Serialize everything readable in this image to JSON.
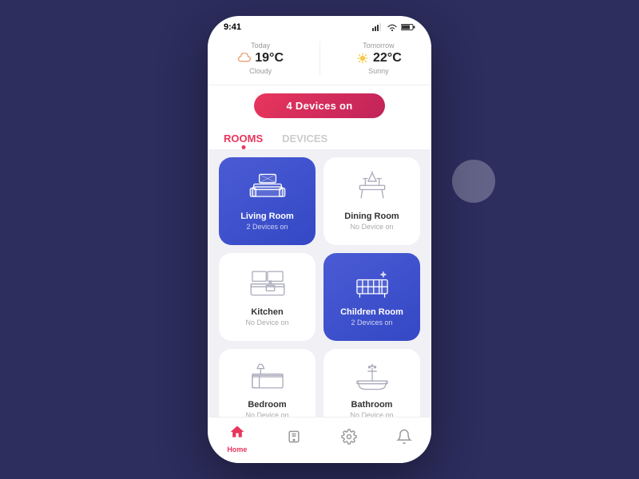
{
  "background": "#2d2d5e",
  "status_bar": {
    "time": "9:41"
  },
  "weather": {
    "today_label": "Today",
    "today_temp": "19°C",
    "today_desc": "Cloudy",
    "tomorrow_label": "Tomorrow",
    "tomorrow_temp": "22°C",
    "tomorrow_desc": "Sunny"
  },
  "devices_btn": "4 Devices on",
  "tabs": [
    {
      "id": "rooms",
      "label": "ROOMS",
      "active": true
    },
    {
      "id": "devices",
      "label": "DEVICES",
      "active": false
    }
  ],
  "rooms": [
    {
      "id": "living-room",
      "name": "Living Room",
      "status": "2 Devices on",
      "active": true
    },
    {
      "id": "dining-room",
      "name": "Dining Room",
      "status": "No Device on",
      "active": false
    },
    {
      "id": "kitchen",
      "name": "Kitchen",
      "status": "No Device on",
      "active": false
    },
    {
      "id": "children-room",
      "name": "Children Room",
      "status": "2 Devices on",
      "active": true
    },
    {
      "id": "bedroom",
      "name": "Bedroom",
      "status": "No Device on",
      "active": false
    },
    {
      "id": "bathroom",
      "name": "Bathroom",
      "status": "No Device on",
      "active": false
    }
  ],
  "nav": {
    "home_label": "Home",
    "items": [
      "home",
      "device",
      "settings",
      "notification"
    ]
  }
}
